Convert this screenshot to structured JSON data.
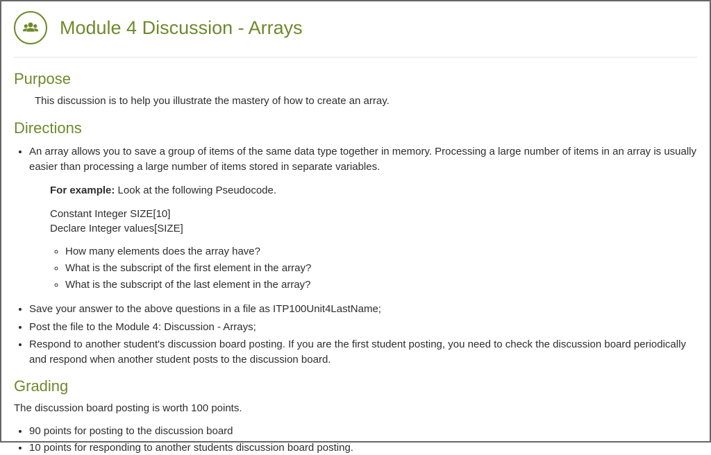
{
  "title": "Module 4 Discussion - Arrays",
  "sections": {
    "purpose": {
      "heading": "Purpose",
      "text": "This discussion is to help you illustrate the mastery of how to create an array."
    },
    "directions": {
      "heading": "Directions",
      "intro_bullet": "An array allows you to save a group of items of the same data type together in memory. Processing a large number of items in an array is usually easier than processing a large number of items stored in separate variables.",
      "example_label": "For example:",
      "example_text": "  Look at the following Pseudocode.",
      "code_l1": "Constant Integer SIZE[10]",
      "code_l2": "Declare Integer values[SIZE]",
      "questions": {
        "q1": "How many elements does the array have?",
        "q2": "What is the subscript of the first element in the array?",
        "q3": "What is the subscript of the last element in the array?"
      },
      "step2": "Save your answer to the above questions in a  file as ITP100Unit4LastName;",
      "step3": "Post the file to the Module 4: Discussion - Arrays;",
      "step4": "Respond to another student's discussion board posting.   If you are the first student posting, you need to check the discussion board periodically and respond when another student posts to the discussion board."
    },
    "grading": {
      "heading": "Grading",
      "intro": "The discussion board posting is worth 100 points.",
      "b1": "90 points for posting to the discussion board",
      "b2": "10 points for responding to another students discussion board posting."
    }
  }
}
